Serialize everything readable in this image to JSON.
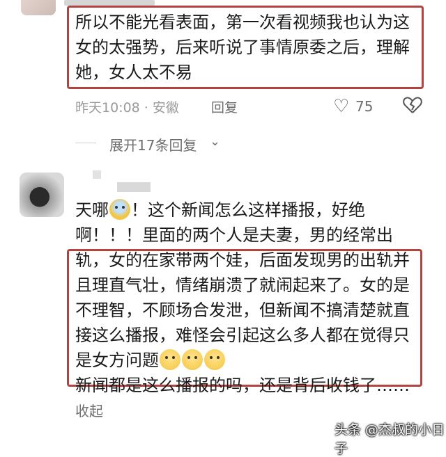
{
  "comment1": {
    "text": "所以不能光看表面，第一次看视频我也认为这女的太强势，后来听说了事情原委之后，理解她，女人太不易",
    "time_location": "昨天10:08 · 安徽",
    "reply_label": "回复",
    "likes": "75"
  },
  "thread": {
    "expand_label": "展开17条回复"
  },
  "comment2": {
    "text_before_emoji": "天哪",
    "text_main": "！这个新闻怎么这样播报，好绝啊！！！里面的两个人是夫妻，男的经常出轨，女的在家带两个娃，后面发现男的出轨并且理直气壮，情绪崩溃了就闹起来了。女的是不理智，不顾场合发泄，但新闻不搞清楚就直接这么播报，难怪会引起这么多人都在觉得只是女方问题",
    "text_after": "新闻都是这么播报的吗，还是背后收钱了……",
    "collapse_label": "收起"
  },
  "watermark": "头条 @杰叔的小日子",
  "icons": {
    "heart": "heart-outline-icon",
    "broken_heart": "broken-heart-icon",
    "chevron": "chevron-down-icon",
    "emoji_scared": "scared-face-emoji",
    "emoji_cry": "crying-face-emoji"
  },
  "colors": {
    "highlight_border": "#b3433f",
    "meta_text": "#9a9a9a"
  }
}
